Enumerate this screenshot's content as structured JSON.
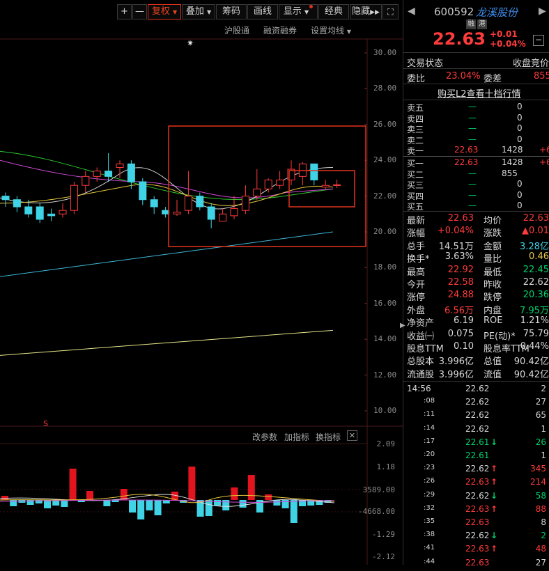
{
  "toolbar": {
    "plus": "+",
    "minus": "—",
    "fuquan": "复权",
    "diejia": "叠加",
    "chouma": "筹码",
    "huaxian": "画线",
    "xianshi": "显示",
    "jingdian": "经典",
    "yincang": "隐藏",
    "sub1": "沪股通",
    "sub2": "融资融券",
    "sub3": "设置均线"
  },
  "price_axis": [
    "30.00",
    "28.00",
    "26.00",
    "24.00",
    "22.00",
    "20.00",
    "18.00",
    "16.00",
    "14.00",
    "12.00",
    "10.00"
  ],
  "indicator": {
    "buttons": [
      "改参数",
      "加指标",
      "换指标"
    ],
    "axis": [
      "2.09",
      "1.18",
      "3589.00",
      "-4668.00",
      "-1.29",
      "-2.12"
    ]
  },
  "chart_data": {
    "type": "candlestick",
    "x": [
      1,
      2,
      3,
      4,
      5,
      6,
      7,
      8,
      9,
      10,
      11,
      12,
      13,
      14,
      15,
      16,
      17,
      18,
      19,
      20,
      21,
      22,
      23,
      24,
      25,
      26,
      27,
      28,
      29,
      30
    ],
    "open": [
      22.0,
      21.8,
      21.4,
      21.4,
      21.0,
      21.0,
      21.2,
      22.6,
      23.1,
      23.4,
      23.6,
      23.8,
      22.8,
      21.8,
      21.2,
      21.0,
      21.2,
      22.0,
      21.4,
      20.6,
      20.9,
      21.2,
      22.0,
      22.4,
      22.6,
      22.9,
      23.1,
      23.8,
      22.5,
      22.6
    ],
    "close": [
      21.8,
      21.4,
      21.0,
      20.7,
      20.9,
      21.2,
      22.6,
      23.1,
      23.4,
      23.1,
      23.8,
      22.8,
      21.8,
      21.4,
      21.0,
      21.1,
      22.0,
      21.4,
      20.7,
      21.0,
      21.3,
      22.0,
      22.4,
      22.9,
      22.9,
      23.5,
      23.8,
      22.9,
      22.6,
      22.63
    ],
    "high": [
      22.2,
      22.0,
      21.8,
      21.6,
      21.3,
      21.6,
      22.8,
      23.4,
      23.6,
      24.4,
      24.0,
      24.0,
      23.0,
      22.0,
      21.4,
      21.8,
      23.4,
      22.2,
      21.6,
      21.3,
      22.0,
      22.6,
      23.5,
      23.0,
      23.4,
      24.0,
      23.9,
      23.2,
      22.9,
      22.92
    ],
    "low": [
      21.4,
      21.1,
      20.8,
      20.5,
      20.6,
      20.8,
      21.0,
      22.2,
      22.8,
      22.8,
      23.0,
      22.4,
      21.5,
      21.0,
      20.8,
      20.9,
      21.0,
      21.2,
      20.2,
      20.6,
      20.7,
      21.0,
      21.8,
      22.2,
      22.4,
      22.6,
      22.6,
      22.6,
      22.4,
      22.45
    ],
    "ylim": [
      10,
      30
    ]
  },
  "side": {
    "code": "600592",
    "name": "龙溪股份",
    "tag1": "融",
    "tag2": "港",
    "price": "22.63",
    "chg": "+0.01",
    "pct": "+0.04%",
    "trade_state_l": "交易状态",
    "trade_state_r": "收盘竞价",
    "weibi_l": "委比",
    "weibi_v": "23.04%",
    "weicha_l": "委差",
    "weicha_v": "855",
    "l2": "购买L2查看十档行情",
    "asks": [
      {
        "n": "卖五",
        "p": "—",
        "v": "0"
      },
      {
        "n": "卖四",
        "p": "—",
        "v": "0"
      },
      {
        "n": "卖三",
        "p": "—",
        "v": "0"
      },
      {
        "n": "卖二",
        "p": "—",
        "v": "0"
      },
      {
        "n": "卖一",
        "p": "22.63",
        "v": "1428",
        "x": "+6"
      }
    ],
    "bids": [
      {
        "n": "买一",
        "p": "22.63",
        "v": "1428",
        "x": "+6"
      },
      {
        "n": "买二",
        "p": "—",
        "v": "855"
      },
      {
        "n": "买三",
        "p": "—",
        "v": "0"
      },
      {
        "n": "买四",
        "p": "—",
        "v": "0"
      },
      {
        "n": "买五",
        "p": "—",
        "v": "0"
      }
    ],
    "stats": [
      [
        "最新",
        "22.63",
        "均价",
        "22.63"
      ],
      [
        "涨幅",
        "+0.04%",
        "涨跌",
        "▲0.01"
      ],
      [
        "总手",
        "14.51万",
        "金额",
        "3.28亿"
      ],
      [
        "换手*",
        "3.63%",
        "量比",
        "0.46"
      ],
      [
        "最高",
        "22.92",
        "最低",
        "22.45"
      ],
      [
        "今开",
        "22.58",
        "昨收",
        "22.62"
      ],
      [
        "涨停",
        "24.88",
        "跌停",
        "20.36"
      ],
      [
        "外盘",
        "6.56万",
        "内盘",
        "7.95万"
      ],
      [
        "净资产",
        "6.19",
        "ROE",
        "1.21%"
      ],
      [
        "收益㈠",
        "0.075",
        "PE(动)*",
        "75.79"
      ],
      [
        "股息TTM",
        "0.10",
        "股息率TTM",
        "0.44%"
      ],
      [
        "总股本",
        "3.996亿",
        "总值",
        "90.42亿"
      ],
      [
        "流通股",
        "3.996亿",
        "流值",
        "90.42亿"
      ]
    ],
    "ticks": [
      [
        "14:56",
        "22.62",
        "",
        "2"
      ],
      [
        ":08",
        "22.62",
        "",
        "27"
      ],
      [
        ":11",
        "22.62",
        "",
        "65"
      ],
      [
        ":14",
        "22.62",
        "",
        "1"
      ],
      [
        ":17",
        "22.61",
        "↓",
        "26"
      ],
      [
        ":20",
        "22.61",
        "",
        "1"
      ],
      [
        ":23",
        "22.62",
        "↑",
        "345"
      ],
      [
        ":26",
        "22.63",
        "↑",
        "214"
      ],
      [
        ":29",
        "22.62",
        "↓",
        "58"
      ],
      [
        ":32",
        "22.63",
        "↑",
        "88"
      ],
      [
        ":35",
        "22.63",
        "",
        "8"
      ],
      [
        ":38",
        "22.62",
        "↓",
        "2"
      ],
      [
        ":41",
        "22.63",
        "↑",
        "48"
      ],
      [
        ":44",
        "22.63",
        "",
        "27"
      ]
    ]
  }
}
